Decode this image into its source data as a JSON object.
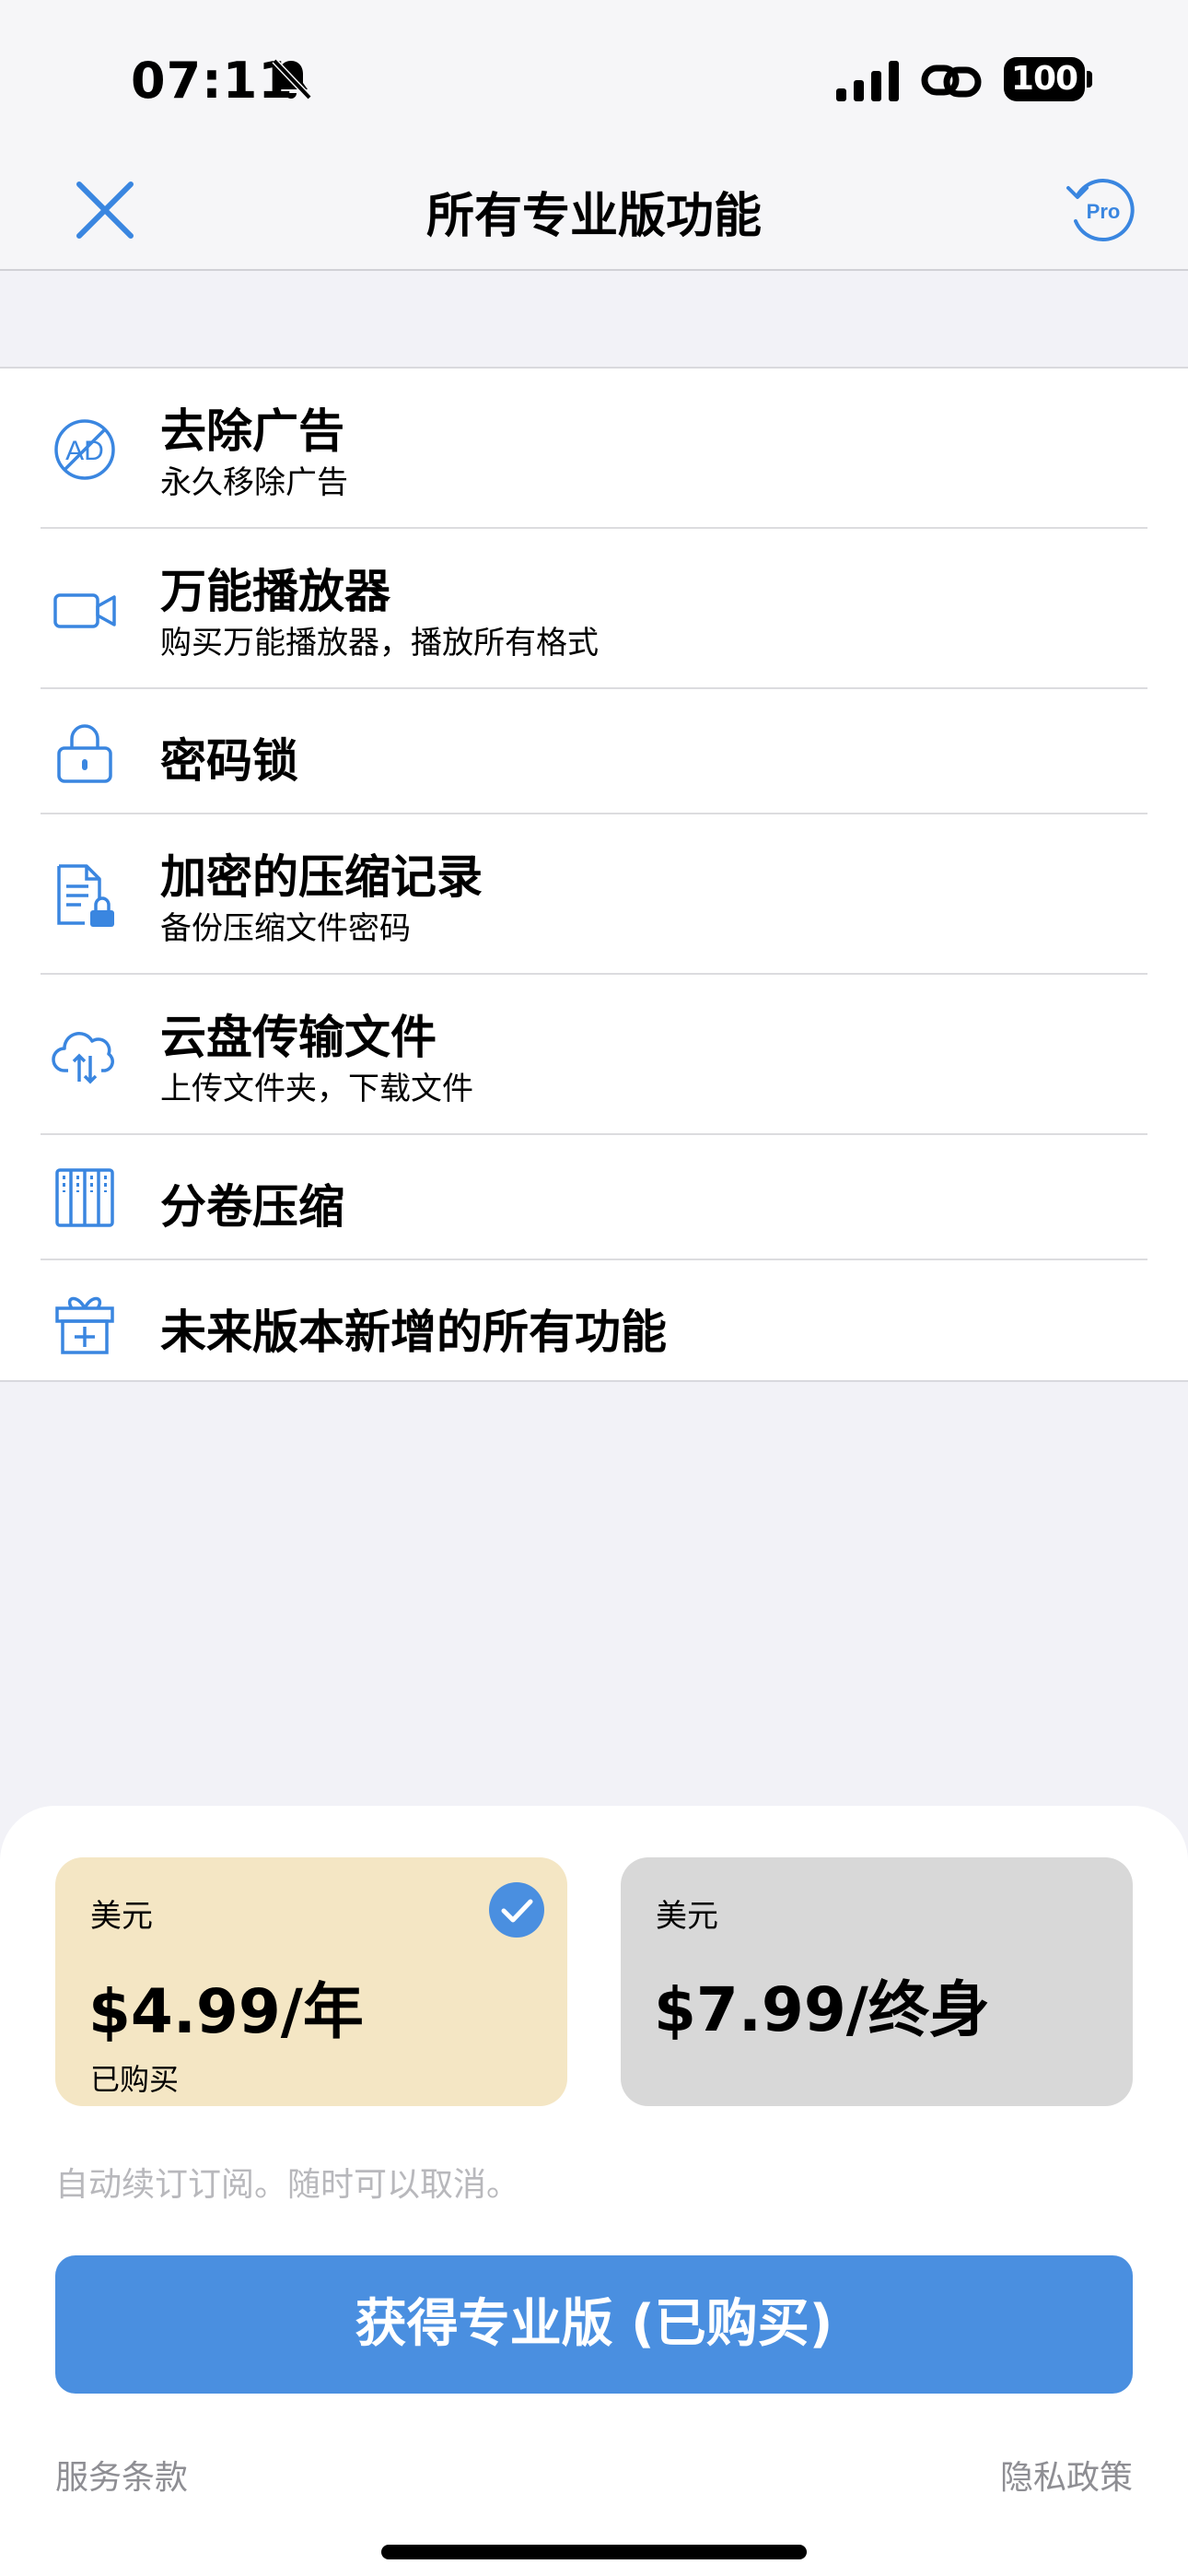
{
  "status_bar": {
    "time": "07:11",
    "battery": "100"
  },
  "nav": {
    "title": "所有专业版功能",
    "restore_icon_label": "Pro"
  },
  "features": [
    {
      "icon": "ad-remove-icon",
      "title": "去除广告",
      "subtitle": "永久移除广告"
    },
    {
      "icon": "video-camera-icon",
      "title": "万能播放器",
      "subtitle": "购买万能播放器，播放所有格式"
    },
    {
      "icon": "lock-icon",
      "title": "密码锁",
      "subtitle": ""
    },
    {
      "icon": "locked-document-icon",
      "title": "加密的压缩记录",
      "subtitle": "备份压缩文件密码"
    },
    {
      "icon": "cloud-transfer-icon",
      "title": "云盘传输文件",
      "subtitle": "上传文件夹，下载文件"
    },
    {
      "icon": "split-volume-icon",
      "title": "分卷压缩",
      "subtitle": ""
    },
    {
      "icon": "gift-icon",
      "title": "未来版本新增的所有功能",
      "subtitle": ""
    }
  ],
  "plans": [
    {
      "currency": "美元",
      "price": "$4.99/年",
      "status": "已购买",
      "selected": true,
      "color": "#f4e6c4"
    },
    {
      "currency": "美元",
      "price": "$7.99/终身",
      "status": "",
      "selected": false,
      "color": "#d8d8d8"
    }
  ],
  "renew_note": "自动续订订阅。随时可以取消。",
  "purchase_button": "获得专业版 (已购买)",
  "links": {
    "terms": "服务条款",
    "privacy": "隐私政策"
  },
  "colors": {
    "accent": "#4a8fe0",
    "icon_blue": "#3a86e0"
  }
}
